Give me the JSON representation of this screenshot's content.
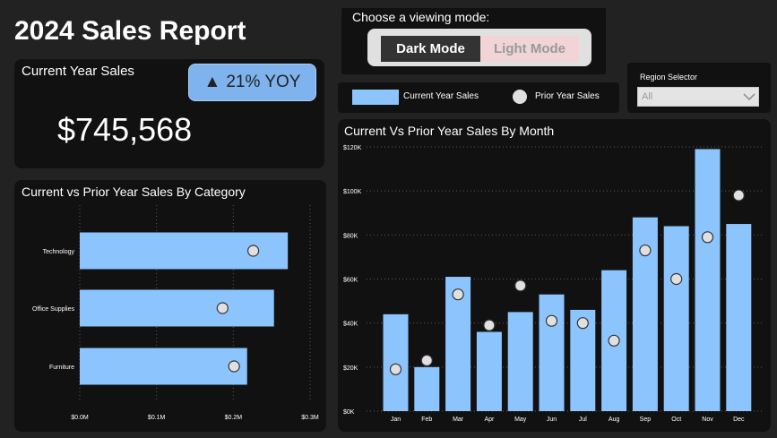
{
  "report": {
    "title": "2024 Sales Report"
  },
  "kpi": {
    "label": "Current Year Sales",
    "value": "$745,568",
    "yoy_arrow": "▲",
    "yoy_text": "21% YOY"
  },
  "viewing_mode": {
    "label": "Choose a viewing mode:",
    "options": [
      "Dark Mode",
      "Light Mode"
    ],
    "selected": "Dark Mode"
  },
  "legend": {
    "current": "Current Year Sales",
    "prior": "Prior Year Sales"
  },
  "region_selector": {
    "label": "Region Selector",
    "value": "All",
    "icon": "chevron-down-icon"
  },
  "colors": {
    "current_bar": "#8cc4fd",
    "prior_dot": "#e0e0e0",
    "panel": "#111111",
    "background": "#222222"
  },
  "chart_data": [
    {
      "type": "bar",
      "orientation": "horizontal",
      "title": "Current vs Prior Year Sales By Category",
      "categories": [
        "Technology",
        "Office Supplies",
        "Furniture"
      ],
      "series": [
        {
          "name": "Current Year Sales",
          "values": [
            0.271,
            0.253,
            0.218
          ]
        },
        {
          "name": "Prior Year Sales",
          "values": [
            0.226,
            0.186,
            0.201
          ]
        }
      ],
      "xlim": [
        0,
        0.3
      ],
      "xticks": [
        "$0.0M",
        "$0.1M",
        "$0.2M",
        "$0.3M"
      ],
      "grid": true
    },
    {
      "type": "bar",
      "orientation": "vertical",
      "title": "Current Vs Prior Year Sales By Month",
      "categories": [
        "Jan",
        "Feb",
        "Mar",
        "Apr",
        "May",
        "Jun",
        "Jul",
        "Aug",
        "Sep",
        "Oct",
        "Nov",
        "Dec"
      ],
      "series": [
        {
          "name": "Current Year Sales",
          "values": [
            44,
            20,
            61,
            36,
            45,
            53,
            46,
            64,
            88,
            84,
            119,
            85
          ]
        },
        {
          "name": "Prior Year Sales",
          "values": [
            19,
            23,
            53,
            39,
            57,
            41,
            40,
            32,
            73,
            60,
            79,
            98
          ]
        }
      ],
      "ylim": [
        0,
        120
      ],
      "yticks": [
        "$0K",
        "$20K",
        "$40K",
        "$60K",
        "$80K",
        "$100K",
        "$120K"
      ],
      "grid": true
    }
  ]
}
